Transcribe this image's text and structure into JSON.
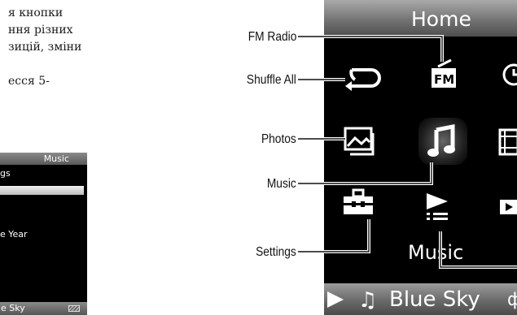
{
  "manual_text": {
    "lines": [
      "я кнопки",
      "ння різних",
      "зицій, зміни",
      "",
      "есся 5-"
    ]
  },
  "mini_screen": {
    "title": "Music",
    "row1": "gs",
    "row2": "e Year",
    "footer": "e Sky"
  },
  "callouts": {
    "fm_radio": "FM Radio",
    "shuffle_all": "Shuffle All",
    "photos": "Photos",
    "music": "Music",
    "settings": "Settings"
  },
  "device": {
    "header_title": "Home",
    "selected_caption": "Music",
    "now_playing_track": "Blue Sky",
    "now_playing_note": "♫",
    "extra_glyph": "ф",
    "icons": [
      "shuffle-icon",
      "fm-radio-icon",
      "clock-icon",
      "photo-icon",
      "music-note-icon",
      "video-icon",
      "settings-toolbox-icon",
      "playlist-icon",
      "play-box-icon"
    ],
    "accent": "#ffffff",
    "background": "#000000"
  }
}
